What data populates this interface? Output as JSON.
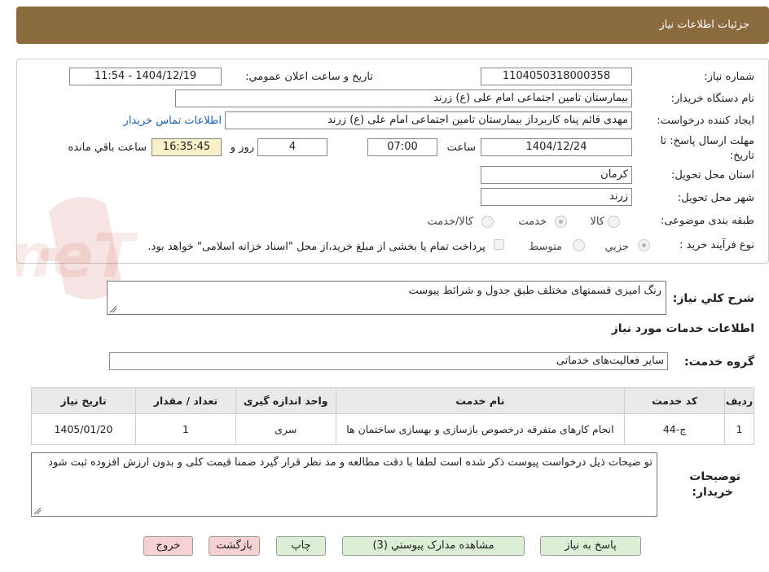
{
  "header": {
    "title": "جزئیات اطلاعات نیاز"
  },
  "form": {
    "need_number_label": "شماره نیاز:",
    "need_number": "1104050318000358",
    "announce_label": "تاریخ و ساعت اعلان عمومي:",
    "announce_value": "1404/12/19 - 11:54",
    "buyer_label": "نام دستگاه خریدار:",
    "buyer_value": "بیمارستان تامین اجتماعی امام علی (ع) زرند",
    "creator_label": "ایجاد کننده درخواست:",
    "creator_value": "مهدی  قائم پناه  کاربرداز بیمارستان تامین اجتماعی امام علی (ع) زرند",
    "contact_link": "اطلاعات تماس خریدار",
    "deadline_label_1": "مهلت ارسال پاسخ: تا",
    "deadline_label_2": "تاریخ:",
    "deadline_date": "1404/12/24",
    "hour_label": "ساعت",
    "deadline_time": "07:00",
    "days_value": "4",
    "days_label": "روز و",
    "remaining_time": "16:35:45",
    "remaining_label": "ساعت باقي مانده",
    "province_label": "استان محل تحویل:",
    "province_value": "کرمان",
    "city_label": "شهر محل تحویل:",
    "city_value": "زرند",
    "category_label": "طبقه بندی موضوعی:",
    "category_options": [
      "کالا",
      "خدمت",
      "کالا/خدمت"
    ],
    "category_selected": "خدمت",
    "process_label": "نوع فرآیند خرید :",
    "process_options": [
      "جزیي",
      "متوسط"
    ],
    "process_selected": "جزیي",
    "payment_note": "پرداخت تمام یا بخشی از مبلغ خرید،از محل \"اسناد خزانه اسلامی\" خواهد بود."
  },
  "watermark": {
    "text": "AriaTender.neT"
  },
  "description": {
    "label": "شرح کلي نیاز:",
    "value": "رنگ امیزی قسمتهای مختلف طبق جدول و شرائط پیوست"
  },
  "services_section": {
    "title": "اطلاعات خدمات مورد نیاز",
    "group_label": "گروه خدمت:",
    "group_value": "سایر فعالیت‌های خدماتی"
  },
  "table": {
    "headers": [
      "ردیف",
      "کد خدمت",
      "نام خدمت",
      "واحد اندازه گیری",
      "تعداد / مقدار",
      "تاریخ نیاز"
    ],
    "rows": [
      [
        "1",
        "ج-44",
        "انجام کارهای متفرقه درخصوص بازسازی و بهسازی ساختمان ها",
        "سری",
        "1",
        "1405/01/20"
      ]
    ]
  },
  "buyer_notes": {
    "label_1": "توضیحات",
    "label_2": "خریدار:",
    "value": "تو ضیحات ذیل درخواست پیوست ذکر شده است لطفا با دقت مطالعه و مد نظر قرار گیرد ضمنا قیمت کلی و بدون ارزش افزوده ثبت شود"
  },
  "buttons": {
    "reply": "پاسخ به نیاز",
    "attachments": "مشاهده مدارک پیوستي (3)",
    "print": "چاپ",
    "back": "بازگشت",
    "exit": "خروج"
  }
}
